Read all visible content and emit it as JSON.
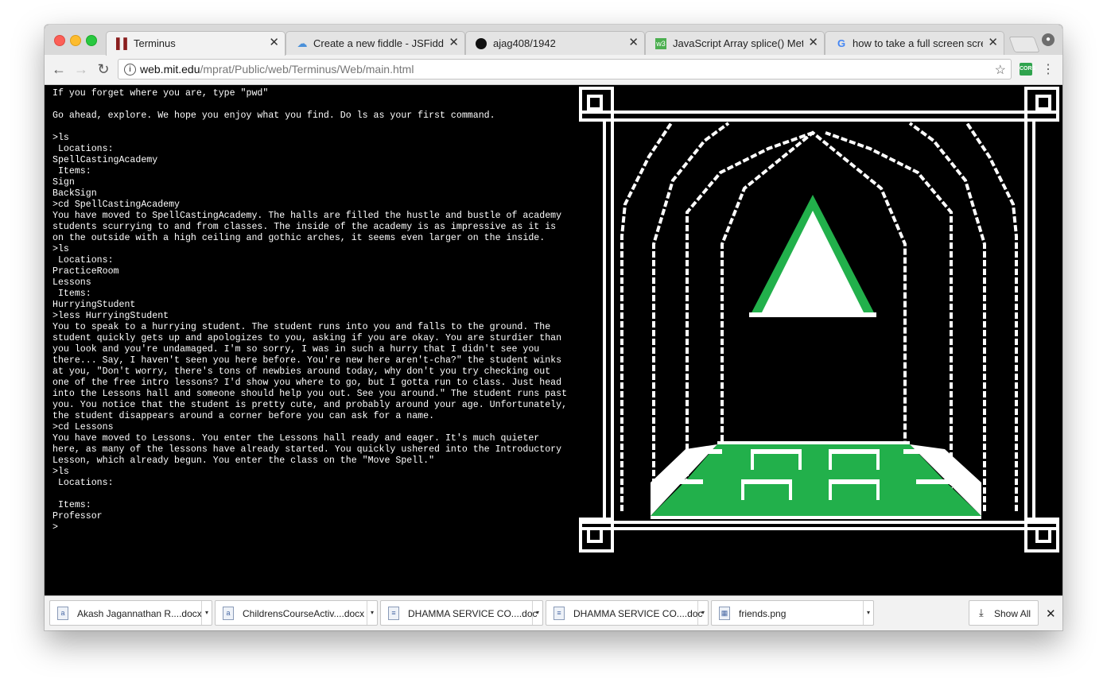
{
  "browser": {
    "tabs": [
      {
        "title": "Terminus",
        "icon": "terminus-favicon",
        "active": true
      },
      {
        "title": "Create a new fiddle - JSFiddle",
        "icon": "jsfiddle-cloud-icon",
        "active": false
      },
      {
        "title": "ajag408/1942",
        "icon": "github-icon",
        "active": false
      },
      {
        "title": "JavaScript Array splice() Meth",
        "icon": "w3schools-icon",
        "active": false
      },
      {
        "title": "how to take a full screen scree",
        "icon": "google-icon",
        "active": false
      }
    ],
    "close_glyph": "✕",
    "url_host": "web.mit.edu",
    "url_path": "/mprat/Public/web/Terminus/Web/main.html",
    "extension_label": "CORS"
  },
  "terminal": {
    "text": "If you forget where you are, type \"pwd\"\n\nGo ahead, explore. We hope you enjoy what you find. Do ls as your first command.\n\n>ls\n Locations:\nSpellCastingAcademy\n Items:\nSign\nBackSign\n>cd SpellCastingAcademy\nYou have moved to SpellCastingAcademy. The halls are filled the hustle and bustle of academy students scurrying to and from classes. The inside of the academy is as impressive as it is on the outside with a high ceiling and gothic arches, it seems even larger on the inside.\n>ls\n Locations:\nPracticeRoom\nLessons\n Items:\nHurryingStudent\n>less HurryingStudent\nYou to speak to a hurrying student. The student runs into you and falls to the ground. The student quickly gets up and apologizes to you, asking if you are okay. You are sturdier than you look and you're undamaged. I'm so sorry, I was in such a hurry that I didn't see you there... Say, I haven't seen you here before. You're new here aren't-cha?\" the student winks at you, \"Don't worry, there's tons of newbies around today, why don't you try checking out one of the free intro lessons? I'd show you where to go, but I gotta run to class. Just head into the Lessons hall and someone should help you out. See you around.\" The student runs past you. You notice that the student is pretty cute, and probably around your age. Unfortunately, the student disappears around a corner before you can ask for a name.\n>cd Lessons\nYou have moved to Lessons. You enter the Lessons hall ready and eager. It's much quieter here, as many of the lessons have already started. You quickly ushered into the Introductory Lesson, which already begun. You enter the class on the \"Move Spell.\"\n>ls\n Locations:\n\n Items:\nProfessor\n>"
  },
  "art": {
    "colors": {
      "frame": "#ffffff",
      "accent": "#22b04b",
      "background": "#000000"
    }
  },
  "downloads": {
    "items": [
      {
        "name": "Akash Jagannathan R....docx",
        "icon": "word-doc-icon"
      },
      {
        "name": "ChildrensCourseActiv....docx",
        "icon": "word-doc-icon"
      },
      {
        "name": "DHAMMA SERVICE CO....doc",
        "icon": "doc-icon"
      },
      {
        "name": "DHAMMA SERVICE CO....doc",
        "icon": "doc-icon"
      },
      {
        "name": "friends.png",
        "icon": "image-file-icon"
      }
    ],
    "show_all_label": "Show All",
    "close_glyph": "✕"
  }
}
